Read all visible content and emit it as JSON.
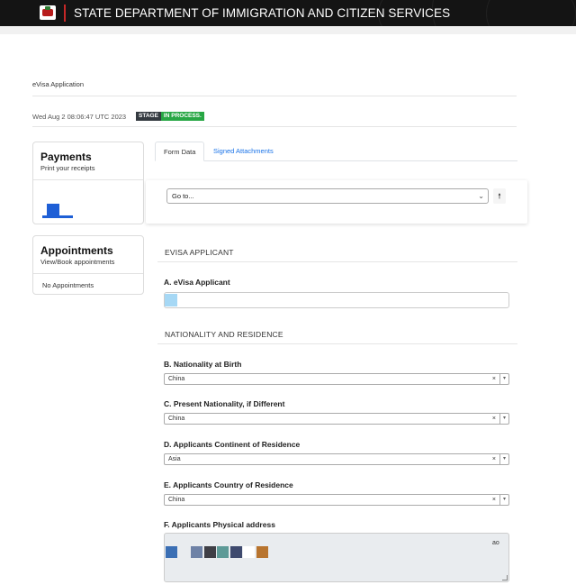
{
  "header": {
    "title": "STATE DEPARTMENT OF IMMIGRATION AND CITIZEN SERVICES",
    "crest": "coat-of-arms-icon"
  },
  "breadcrumb": "eVisa Application",
  "timestamp": "Wed Aug 2 08:06:47 UTC 2023",
  "stage": {
    "label": "STAGE",
    "value": "IN PROCESS."
  },
  "payments": {
    "title": "Payments",
    "subtitle": "Print your receipts"
  },
  "appointments": {
    "title": "Appointments",
    "subtitle": "View/Book appointments",
    "empty_text": "No Appointments"
  },
  "tabs": {
    "form_data": "Form Data",
    "signed_attachments": "Signed Attachments"
  },
  "goto": {
    "value": "Go to...",
    "up_icon": "arrow-up-icon"
  },
  "sections": {
    "applicant": "EVISA APPLICANT",
    "nationality": "NATIONALITY AND RESIDENCE"
  },
  "fields": {
    "a_label": "A. eVisa Applicant",
    "b_label": "B. Nationality at Birth",
    "b_value": "China",
    "c_label": "C. Present Nationality, if Different",
    "c_value": "China",
    "d_label": "D. Applicants Continent of Residence",
    "d_value": "Asia",
    "e_label": "E. Applicants Country of Residence",
    "e_value": "China",
    "f_label": "F. Applicants Physical address",
    "f_value_tail": "ao"
  },
  "colors": {
    "stage_badge": "#28a745",
    "link": "#1a73e8",
    "header_bg": "#141414",
    "accent_red": "#c62828"
  },
  "select_clear_glyph": "×",
  "select_arrow_glyph": "▾"
}
